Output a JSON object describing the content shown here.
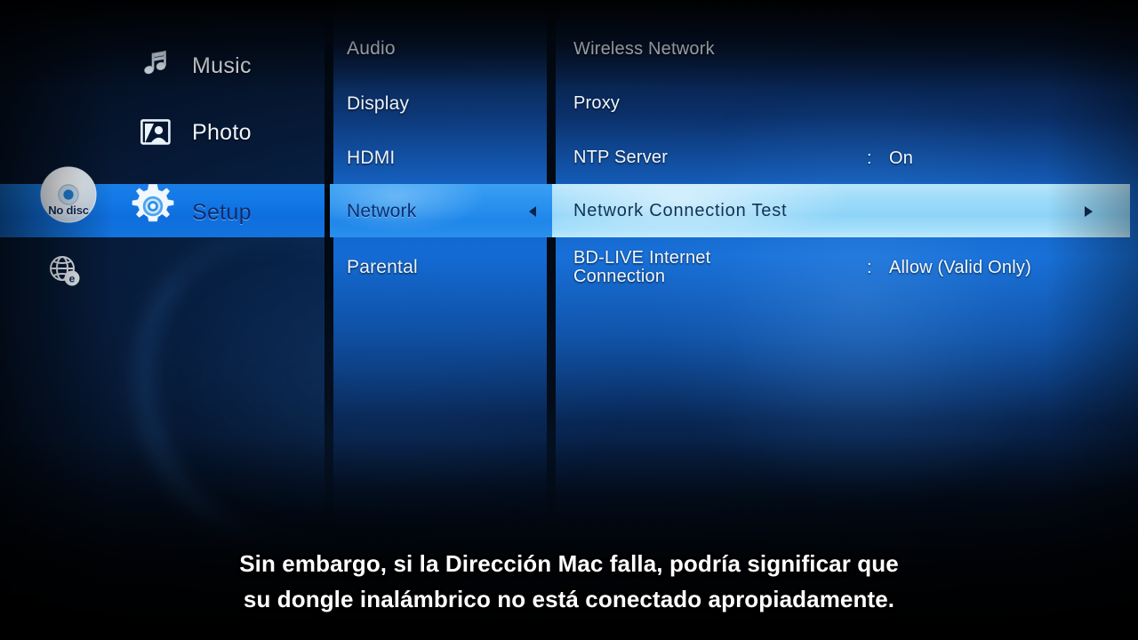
{
  "device": {
    "disc_status": "No disc",
    "disc_icon": "disc-icon",
    "internet_icon": "globe-e-icon"
  },
  "main_menu": {
    "items": [
      {
        "label": "Music",
        "icon": "music-note-icon",
        "selected": false
      },
      {
        "label": "Photo",
        "icon": "photo-frame-icon",
        "selected": false
      },
      {
        "label": "Setup",
        "icon": "gear-icon",
        "selected": true
      }
    ]
  },
  "setup_categories": {
    "items": [
      {
        "label": "Audio",
        "selected": false,
        "has_arrow": false
      },
      {
        "label": "Display",
        "selected": false,
        "has_arrow": false
      },
      {
        "label": "HDMI",
        "selected": false,
        "has_arrow": false
      },
      {
        "label": "Network",
        "selected": true,
        "has_arrow": true,
        "arrow": "chevron-left-icon"
      },
      {
        "label": "Parental",
        "selected": false,
        "has_arrow": false
      }
    ]
  },
  "network_options": {
    "items": [
      {
        "label": "Wireless Network",
        "colon": "",
        "value": "",
        "selected": false,
        "has_arrow": false
      },
      {
        "label": "Proxy",
        "colon": "",
        "value": "",
        "selected": false,
        "has_arrow": false
      },
      {
        "label": "NTP Server",
        "colon": ":",
        "value": "On",
        "selected": false,
        "has_arrow": false
      },
      {
        "label": "Network Connection Test",
        "colon": "",
        "value": "",
        "selected": true,
        "has_arrow": true,
        "arrow": "chevron-right-icon"
      },
      {
        "label": "BD-LIVE Internet\nConnection",
        "colon": ":",
        "value": "Allow (Valid Only)",
        "selected": false,
        "has_arrow": false
      }
    ]
  },
  "subtitle": {
    "line1": "Sin embargo, si la Dirección Mac falla, podría significar que",
    "line2": "su dongle inalámbrico no está conectado apropiadamente."
  },
  "colors": {
    "highlight_left": "#1279e6",
    "highlight_mid": "#2b93ef",
    "highlight_right": "#9fdcfa",
    "panel_blue": "#1470dc",
    "selected_text": "#0d2f6f",
    "text_white": "#f0f7ff",
    "background_dark": "#020308"
  }
}
